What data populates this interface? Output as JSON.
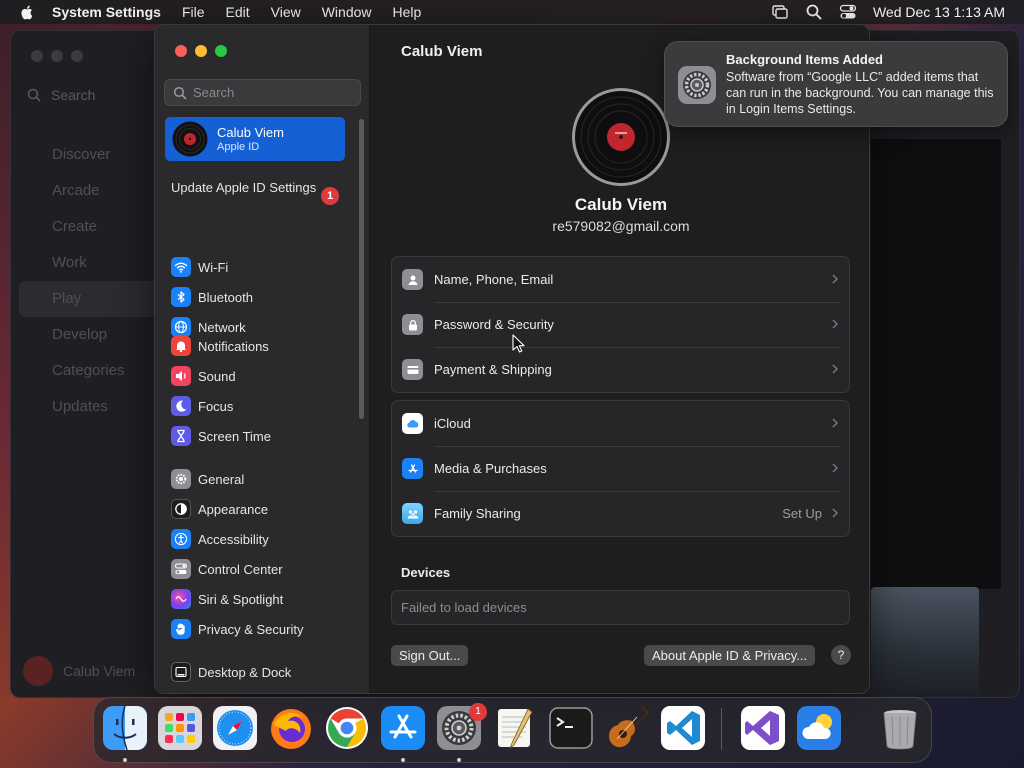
{
  "menubar": {
    "app_name": "System Settings",
    "menus": [
      "File",
      "Edit",
      "View",
      "Window",
      "Help"
    ],
    "clock": "Wed Dec 13  1:13 AM"
  },
  "background_window": {
    "search_label": "Search",
    "nav": [
      "Discover",
      "Arcade",
      "Create",
      "Work",
      "Play",
      "Develop",
      "Categories",
      "Updates"
    ],
    "selected": "Play",
    "user": "Calub Viem"
  },
  "sidebar": {
    "search_placeholder": "Search",
    "account": {
      "name": "Calub Viem",
      "subtitle": "Apple ID"
    },
    "update": {
      "label": "Update Apple ID Settings",
      "badge": "1"
    },
    "groups": [
      [
        {
          "label": "Wi-Fi",
          "icon": "wifi-icon",
          "color": "#1a82f7"
        },
        {
          "label": "Bluetooth",
          "icon": "bluetooth-icon",
          "color": "#1a82f7"
        },
        {
          "label": "Network",
          "icon": "globe-icon",
          "color": "#1a82f7"
        }
      ],
      [
        {
          "label": "Notifications",
          "icon": "bell-icon",
          "color": "#f0443a"
        },
        {
          "label": "Sound",
          "icon": "speaker-icon",
          "color": "#f0445f"
        },
        {
          "label": "Focus",
          "icon": "moon-icon",
          "color": "#5e5ce6"
        },
        {
          "label": "Screen Time",
          "icon": "hourglass-icon",
          "color": "#5e5ce6"
        }
      ],
      [
        {
          "label": "General",
          "icon": "gear-icon",
          "color": "#8e8e93"
        },
        {
          "label": "Appearance",
          "icon": "appearance-icon",
          "color": "#1c1c1e"
        },
        {
          "label": "Accessibility",
          "icon": "accessibility-icon",
          "color": "#1a82f7"
        },
        {
          "label": "Control Center",
          "icon": "control-center-icon",
          "color": "#8e8e93"
        },
        {
          "label": "Siri & Spotlight",
          "icon": "siri-icon",
          "color": "#b44fd6"
        },
        {
          "label": "Privacy & Security",
          "icon": "hand-icon",
          "color": "#1a82f7"
        }
      ],
      [
        {
          "label": "Desktop & Dock",
          "icon": "dock-icon",
          "color": "#1c1c1e"
        }
      ]
    ]
  },
  "main": {
    "title": "Calub Viem",
    "profile": {
      "name": "Calub Viem",
      "email": "re579082@gmail.com"
    },
    "group1": [
      {
        "label": "Name, Phone, Email",
        "icon": "person-icon",
        "color": "#8e8e93"
      },
      {
        "label": "Password & Security",
        "icon": "lock-icon",
        "color": "#8e8e93"
      },
      {
        "label": "Payment & Shipping",
        "icon": "card-icon",
        "color": "#8e8e93"
      }
    ],
    "group2": [
      {
        "label": "iCloud",
        "icon": "icloud-icon",
        "color": "#ffffff"
      },
      {
        "label": "Media & Purchases",
        "icon": "app-store-icon",
        "color": "#1a82f7"
      },
      {
        "label": "Family Sharing",
        "icon": "family-icon",
        "color": "#5ac8fa",
        "value": "Set Up"
      }
    ],
    "devices": {
      "title": "Devices",
      "status": "Failed to load devices"
    },
    "buttons": {
      "sign_out": "Sign Out...",
      "about": "About Apple ID & Privacy...",
      "help": "?"
    }
  },
  "notification": {
    "title": "Background Items Added",
    "body": "Software from “Google LLC” added items that can run in the background. You can manage this in Login Items Settings."
  },
  "dock": {
    "apps": [
      "Finder",
      "Launchpad",
      "Safari",
      "Firefox",
      "Chrome",
      "App Store",
      "System Settings",
      "TextEdit",
      "Terminal",
      "GarageBand",
      "Visual Studio Code",
      "Visual Studio",
      "Weather",
      "Trash"
    ],
    "settings_badge": "1"
  }
}
